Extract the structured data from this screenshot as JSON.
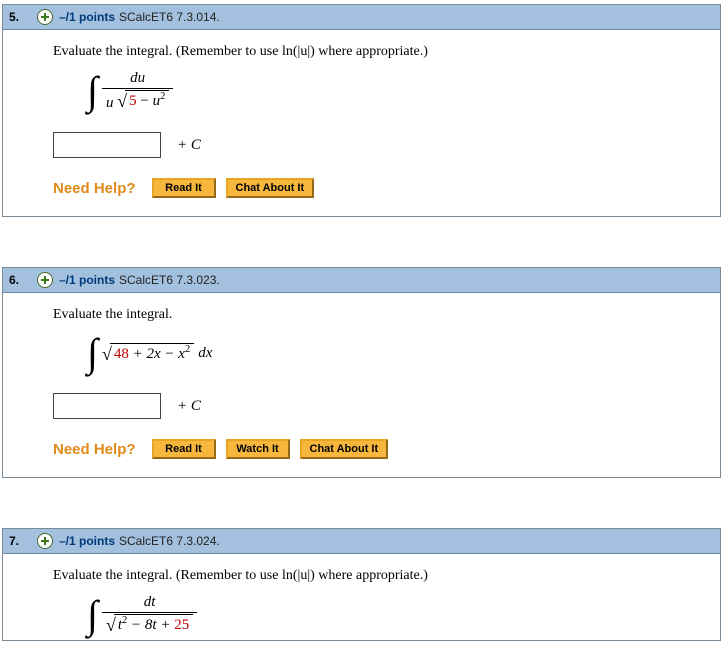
{
  "questions": [
    {
      "number": "5.",
      "points": "–/1 points",
      "ref": "SCalcET6 7.3.014.",
      "instruction": "Evaluate the integral. (Remember to use ln(|u|) where appropriate.)",
      "math": {
        "type": "frac",
        "numerator_var": "du",
        "den_prefix_var": "u",
        "radicand_const": "5",
        "radicand_op": " − ",
        "radicand_var": "u",
        "radicand_exp": "2"
      },
      "plus_c": "+ C",
      "help_label": "Need Help?",
      "buttons": [
        "Read It",
        "Chat About It"
      ]
    },
    {
      "number": "6.",
      "points": "–/1 points",
      "ref": "SCalcET6 7.3.023.",
      "instruction": "Evaluate the integral.",
      "math": {
        "type": "sqrt_poly",
        "radicand_const": "48",
        "radicand_mid": " + 2x − ",
        "radicand_var": "x",
        "radicand_exp": "2",
        "dx": "dx"
      },
      "plus_c": "+ C",
      "help_label": "Need Help?",
      "buttons": [
        "Read It",
        "Watch It",
        "Chat About It"
      ]
    },
    {
      "number": "7.",
      "points": "–/1 points",
      "ref": "SCalcET6 7.3.024.",
      "instruction": "Evaluate the integral. (Remember to use ln(|u|) where appropriate.)",
      "math": {
        "type": "frac2",
        "numerator_var": "dt",
        "radicand_var": "t",
        "radicand_exp": "2",
        "radicand_mid": " − 8t + ",
        "radicand_const": "25"
      }
    }
  ]
}
